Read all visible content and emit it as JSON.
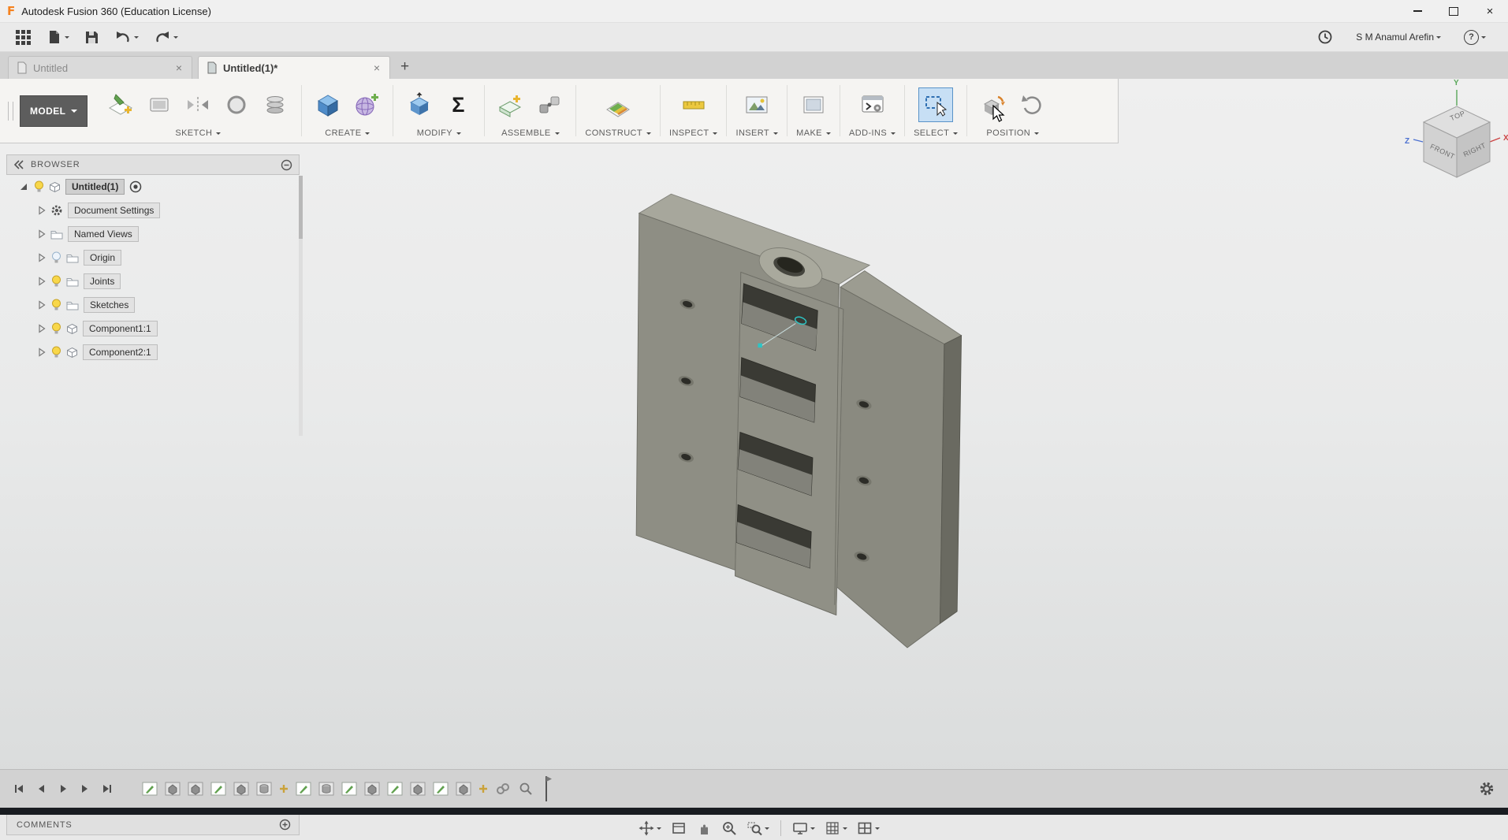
{
  "glyphs": {
    "close": "×",
    "plus": "+",
    "sigma": "Σ",
    "question": "?",
    "logo": "F"
  },
  "window": {
    "title": "Autodesk Fusion 360 (Education License)"
  },
  "qat": {
    "user_name": "S M Anamul Arefin"
  },
  "tabs": {
    "inactive_label": "Untitled",
    "active_label": "Untitled(1)*"
  },
  "ribbon": {
    "workspace_label": "MODEL",
    "groups": [
      {
        "label": "SKETCH"
      },
      {
        "label": "CREATE"
      },
      {
        "label": "MODIFY"
      },
      {
        "label": "ASSEMBLE"
      },
      {
        "label": "CONSTRUCT"
      },
      {
        "label": "INSPECT"
      },
      {
        "label": "INSERT"
      },
      {
        "label": "MAKE"
      },
      {
        "label": "ADD-INS"
      },
      {
        "label": "SELECT"
      },
      {
        "label": "POSITION"
      }
    ]
  },
  "browser": {
    "header": "BROWSER",
    "root_label": "Untitled(1)",
    "items": [
      "Document Settings",
      "Named Views",
      "Origin",
      "Joints",
      "Sketches",
      "Component1:1",
      "Component2:1"
    ]
  },
  "comments": {
    "header": "COMMENTS"
  },
  "viewcube": {
    "top": "TOP",
    "front": "FRONT",
    "right": "RIGHT",
    "axis_x": "X",
    "axis_y": "Y",
    "axis_z": "Z"
  },
  "timeline": {
    "features": [
      "sketch",
      "extrude",
      "extrude",
      "sketch",
      "extrude",
      "cylinder",
      "plus",
      "sketch",
      "cylinder",
      "sketch",
      "extrude",
      "sketch",
      "extrude",
      "sketch",
      "extrude",
      "plus",
      "link",
      "zoom"
    ]
  },
  "icon_names": [
    "app-grid-icon",
    "file-menu-icon",
    "save-icon",
    "undo-icon",
    "redo-icon",
    "job-status-clock-icon",
    "help-icon",
    "create-sketch-icon",
    "sketch-palette-icon",
    "mirror-icon",
    "sketch-circle-icon",
    "coil-icon",
    "box-icon",
    "form-icon",
    "press-pull-icon",
    "parameters-sigma-icon",
    "new-component-icon",
    "joint-icon",
    "construct-plane-icon",
    "measure-icon",
    "insert-image-icon",
    "make-icon",
    "add-ins-icon",
    "select-icon",
    "capture-position-icon",
    "revert-position-icon",
    "pan-icon",
    "fit-icon",
    "hand-icon",
    "zoom-icon",
    "zoom-window-icon",
    "display-settings-icon",
    "grid-display-icon",
    "viewports-icon",
    "settings-gear-icon",
    "lightbulb-icon",
    "folder-icon",
    "component-icon",
    "gear-icon",
    "activate-radio-icon"
  ]
}
